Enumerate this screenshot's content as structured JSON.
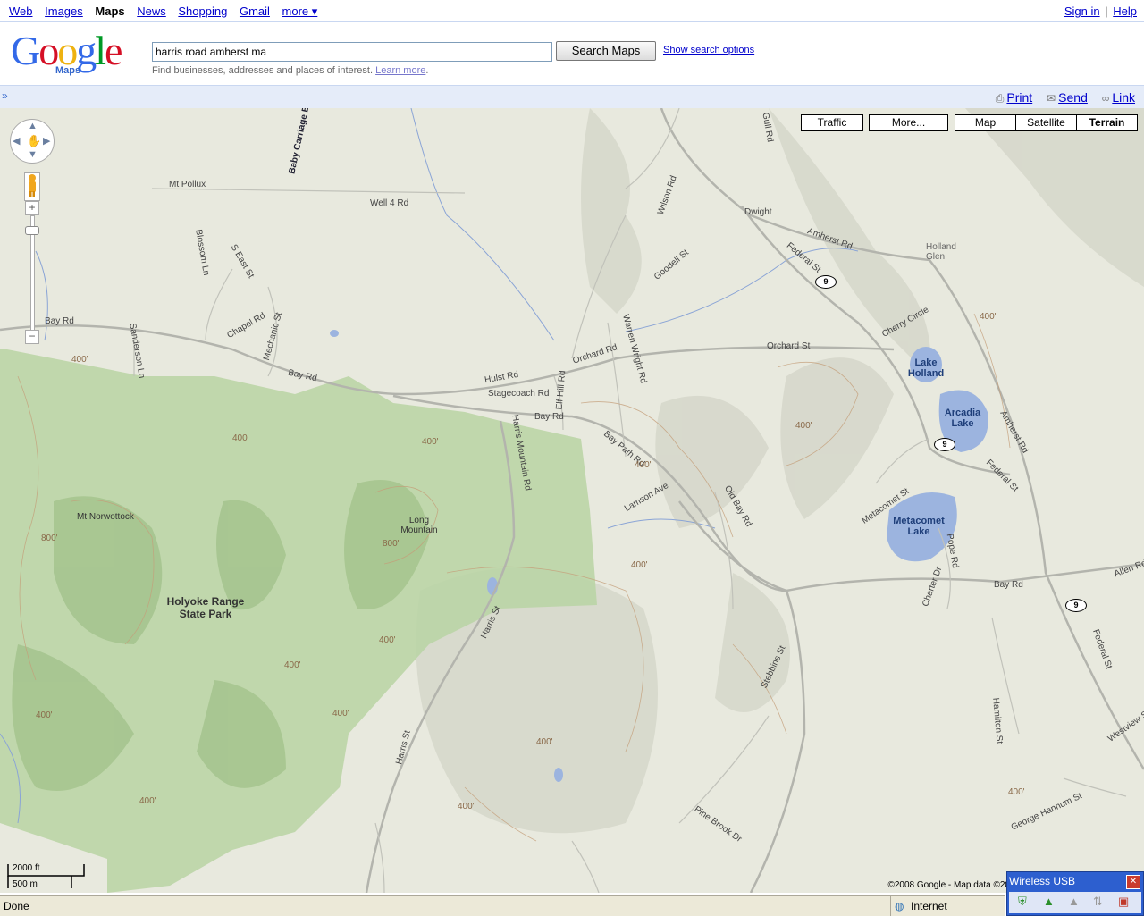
{
  "topnav": {
    "links": [
      "Web",
      "Images",
      "Maps",
      "News",
      "Shopping",
      "Gmail",
      "more ▾"
    ],
    "active": "Maps",
    "sign_in": "Sign in",
    "separator": "|",
    "help": "Help"
  },
  "header": {
    "logo_text": "Google",
    "logo_sub": "Maps",
    "search_value": "harris road amherst ma",
    "search_button": "Search Maps",
    "show_options": "Show search options",
    "hint_text": "Find businesses, addresses and places of interest.",
    "learn_more": "Learn more"
  },
  "toolbar": {
    "expand": "»",
    "print": "Print",
    "send": "Send",
    "link": "Link"
  },
  "map": {
    "buttons": {
      "traffic": "Traffic",
      "more": "More...",
      "map": "Map",
      "satellite": "Satellite",
      "terrain": "Terrain"
    },
    "selected_type": "Terrain",
    "scale_ft": "2000 ft",
    "scale_m": "500 m",
    "copyright": "©2008 Google - Map data ©20",
    "labels": {
      "mt_pollux": "Mt Pollux",
      "dwight": "Dwight",
      "holland_glen": "Holland Glen",
      "lake_holland": "Lake Holland",
      "arcadia_lake": "Arcadia Lake",
      "metacomet_lake": "Metacomet Lake",
      "mt_norwottock": "Mt Norwottock",
      "long_mountain": "Long Mountain",
      "holyoke_range": "Holyoke Range State Park",
      "well4": "Well 4 Rd",
      "bay_rd_1": "Bay Rd",
      "bay_rd_2": "Bay Rd",
      "bay_rd_3": "Bay Rd",
      "bay_rd_4": "Bay Rd",
      "orchard_1": "Orchard Rd",
      "orchard_2": "Orchard St",
      "hulst": "Hulst Rd",
      "stagecoach": "Stagecoach Rd",
      "amherst_rd_1": "Amherst Rd",
      "amherst_rd_2": "Amherst Rd",
      "federal_1": "Federal St",
      "federal_2": "Federal St",
      "federal_3": "Federal St",
      "harris_mtn": "Harris Mountain Rd",
      "harris_st": "Harris St",
      "lamson": "Lamson Ave",
      "old_bay": "Old Bay Rd",
      "metacomet_st": "Metacomet St",
      "stebbins": "Stebbins St",
      "pine_brook": "Pine Brook Dr",
      "george_hannum": "George Hannum St",
      "hamilton": "Hamilton St",
      "chapel": "Chapel Rd",
      "mechanic": "Mechanic St",
      "sanderson": "Sanderson Ln",
      "blossom": "Blossom Ln",
      "seast": "S East St",
      "goodell": "Goodell St",
      "wilson": "Wilson Rd",
      "warren_wright": "Warren Wright Rd",
      "cherry": "Cherry Circle",
      "elf_hill": "Elf Hill Rd",
      "bay_path": "Bay Path Rd",
      "baby_carriage": "Baby Carriage B",
      "pope": "Pope Rd",
      "charter": "Charter Dr",
      "allen": "Allen Rd",
      "westview": "Westview St",
      "gull": "Gull Rd",
      "elev": [
        "400'",
        "400'",
        "400'",
        "400'",
        "400'",
        "400'",
        "800'",
        "800'",
        "400'",
        "400'",
        "400'",
        "400'",
        "400'",
        "400'",
        "400'",
        "400'",
        "400'"
      ]
    },
    "route_numbers": [
      "9",
      "9",
      "9"
    ]
  },
  "wifi_popup": {
    "title": "Wireless USB",
    "close": "✕"
  },
  "statusbar": {
    "text": "Done",
    "zone": "Internet"
  },
  "colors": {
    "link": "#0000cc",
    "toolbar_bg": "#e5ecf9",
    "park_green": "#b9d3a3",
    "water": "#9cb4df"
  }
}
